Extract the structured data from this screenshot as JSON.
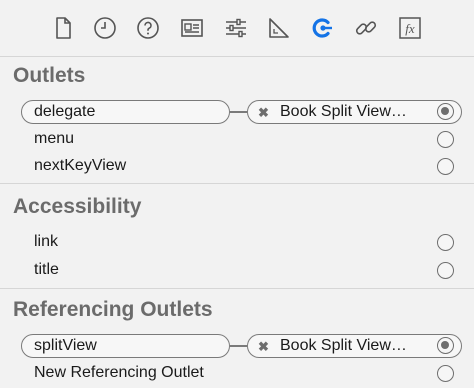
{
  "toolbar": {
    "icons": [
      "file-icon",
      "clock-icon",
      "help-icon",
      "identity-inspector-icon",
      "sliders-icon",
      "ruler-icon",
      "connections-icon",
      "bindings-icon",
      "effects-icon"
    ],
    "fx_label": "fx",
    "selected_icon": "connections-icon",
    "accent_color": "#1473e6"
  },
  "outlets": {
    "title": "Outlets",
    "items": [
      {
        "label": "delegate",
        "connected": true,
        "target": "Book Split View…"
      },
      {
        "label": "menu",
        "connected": false
      },
      {
        "label": "nextKeyView",
        "connected": false
      }
    ]
  },
  "accessibility": {
    "title": "Accessibility",
    "items": [
      {
        "label": "link",
        "connected": false
      },
      {
        "label": "title",
        "connected": false
      }
    ]
  },
  "referencing_outlets": {
    "title": "Referencing Outlets",
    "items": [
      {
        "label": "splitView",
        "connected": true,
        "target": "Book Split View…"
      },
      {
        "label": "New Referencing Outlet",
        "connected": false
      }
    ]
  },
  "disconnect_glyph": "✖"
}
